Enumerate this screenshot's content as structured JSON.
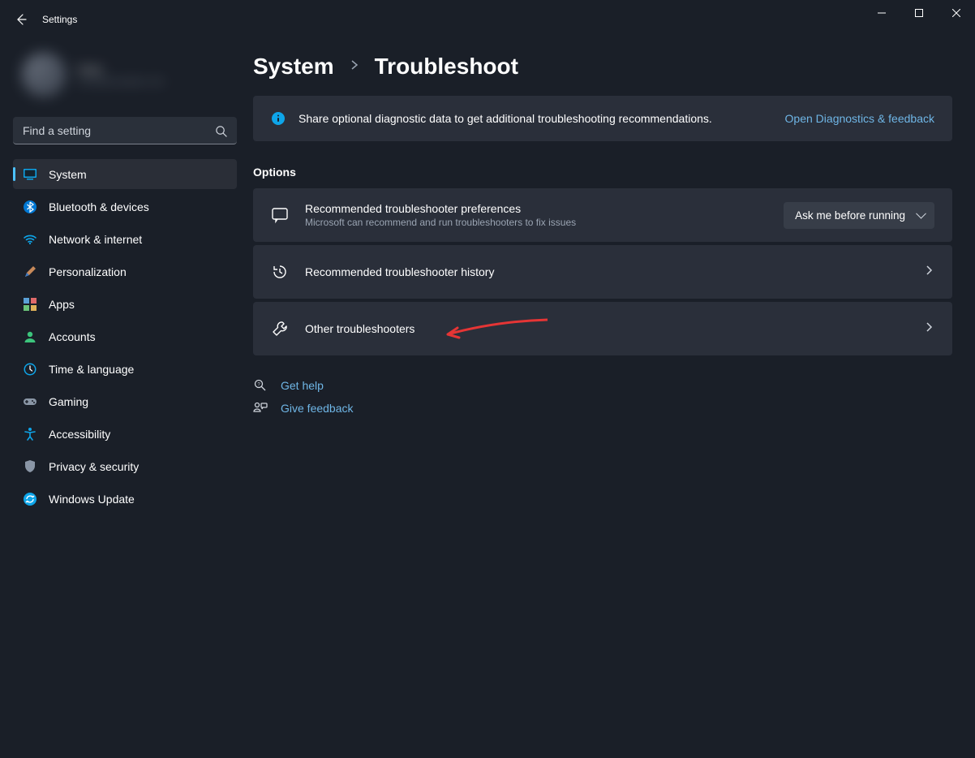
{
  "window": {
    "title": "Settings"
  },
  "user": {
    "name": "User",
    "sub": "user@example.com"
  },
  "search": {
    "placeholder": "Find a setting"
  },
  "sidebar": {
    "items": [
      {
        "label": "System"
      },
      {
        "label": "Bluetooth & devices"
      },
      {
        "label": "Network & internet"
      },
      {
        "label": "Personalization"
      },
      {
        "label": "Apps"
      },
      {
        "label": "Accounts"
      },
      {
        "label": "Time & language"
      },
      {
        "label": "Gaming"
      },
      {
        "label": "Accessibility"
      },
      {
        "label": "Privacy & security"
      },
      {
        "label": "Windows Update"
      }
    ]
  },
  "breadcrumb": {
    "parent": "System",
    "current": "Troubleshoot"
  },
  "info": {
    "text": "Share optional diagnostic data to get additional troubleshooting recommendations.",
    "link": "Open Diagnostics & feedback"
  },
  "section": {
    "options": "Options"
  },
  "cards": {
    "pref": {
      "title": "Recommended troubleshooter preferences",
      "sub": "Microsoft can recommend and run troubleshooters to fix issues",
      "dropdown": "Ask me before running"
    },
    "history": {
      "title": "Recommended troubleshooter history"
    },
    "other": {
      "title": "Other troubleshooters"
    }
  },
  "help": {
    "get": "Get help",
    "feedback": "Give feedback"
  }
}
